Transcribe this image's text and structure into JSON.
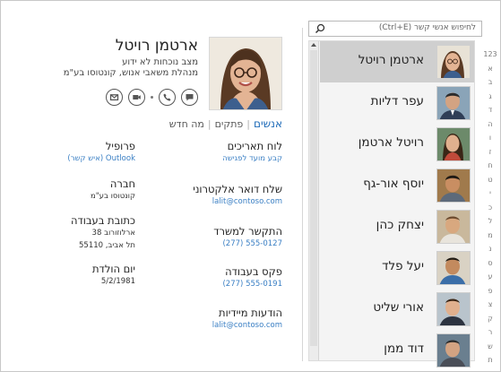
{
  "search": {
    "placeholder": "לחיפוש אנשי קשר (Ctrl+E)",
    "icon": "search-icon"
  },
  "contact": {
    "name": "ארטמן רויטל",
    "status_lines": [
      "מצב נוכחות לא ידוע",
      "מנהלת משאבי אנוש, קונטוסו בע\"מ"
    ],
    "actions": [
      {
        "icon": "chat-icon"
      },
      {
        "icon": "phone-icon"
      },
      {
        "icon": "video-icon"
      },
      {
        "icon": "email-icon"
      }
    ],
    "tabs": [
      {
        "label": "אנשים",
        "active": true
      },
      {
        "label": "פתקים",
        "active": false
      },
      {
        "label": "מה חדש",
        "active": false
      }
    ],
    "fields_right": [
      {
        "label": "לוח תאריכים",
        "value": "קבע מועד לפגישה"
      },
      {
        "label": "שלח דואר אלקטרוני",
        "value": "lalit@contoso.com"
      },
      {
        "label": "התקשר למשרד",
        "value": "555-0127 (277)"
      },
      {
        "label": "פקס בעבודה",
        "value": "555-0191 (277)"
      },
      {
        "label": "הודעות מיידיות",
        "value": "lalit@contoso.com"
      }
    ],
    "fields_left": [
      {
        "label": "פרופיל",
        "value": "Outlook (איש קשר)"
      },
      {
        "label": "חברה",
        "value": "קונטוסו בע\"מ"
      },
      {
        "label": "כתובת בעבודה",
        "value_lines": [
          "ארלוזורוב 38",
          "תל אביב, 55110"
        ]
      },
      {
        "label": "יום הולדת",
        "value": "5/2/1981"
      }
    ]
  },
  "list": {
    "items": [
      {
        "name": "ארטמן רויטל",
        "selected": true
      },
      {
        "name": "עפר דליות",
        "selected": false
      },
      {
        "name": "רויטל ארטמן",
        "selected": false
      },
      {
        "name": "יוסף אור-גף",
        "selected": false
      },
      {
        "name": "יצחק כהן",
        "selected": false
      },
      {
        "name": "יעל פלד",
        "selected": false
      },
      {
        "name": "אורי שליט",
        "selected": false
      },
      {
        "name": "דוד ממן",
        "selected": false
      }
    ]
  },
  "alphabet": [
    "123",
    "א",
    "ב",
    "ג",
    "ד",
    "ה",
    "ו",
    "ז",
    "ח",
    "ט",
    "י",
    "כ",
    "ל",
    "מ",
    "נ",
    "ס",
    "ע",
    "פ",
    "צ",
    "ק",
    "ר",
    "ש",
    "ת"
  ],
  "colors": {
    "accent": "#1e6bb8",
    "link": "#3a7fc4",
    "selected_row": "#cfcfcf"
  }
}
